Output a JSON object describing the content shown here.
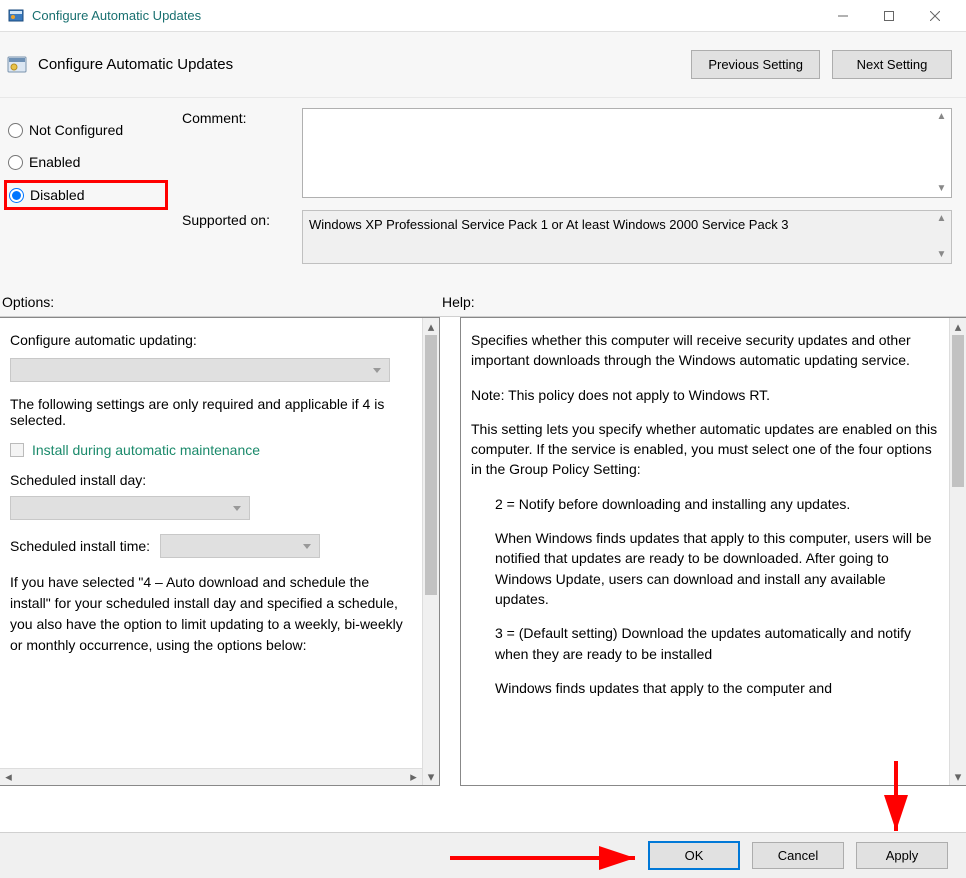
{
  "window": {
    "title": "Configure Automatic Updates"
  },
  "header": {
    "policy_title": "Configure Automatic Updates",
    "prev_button": "Previous Setting",
    "next_button": "Next Setting"
  },
  "state_radios": {
    "not_configured": "Not Configured",
    "enabled": "Enabled",
    "disabled": "Disabled",
    "selected": "disabled"
  },
  "fields": {
    "comment_label": "Comment:",
    "comment_value": "",
    "supported_label": "Supported on:",
    "supported_value": "Windows XP Professional Service Pack 1 or At least Windows 2000 Service Pack 3"
  },
  "labels": {
    "options": "Options:",
    "help": "Help:"
  },
  "options": {
    "configure_label": "Configure automatic updating:",
    "note1": "The following settings are only required and applicable if 4 is selected.",
    "maintenance_label": "Install during automatic maintenance",
    "day_label": "Scheduled install day:",
    "time_label": "Scheduled install time:",
    "note2": "If you have selected \"4 – Auto download and schedule the install\" for your scheduled install day and specified a schedule, you also have the option to limit updating to a weekly, bi-weekly or monthly occurrence, using the options below:"
  },
  "help": {
    "p1": "Specifies whether this computer will receive security updates and other important downloads through the Windows automatic updating service.",
    "p2": "Note: This policy does not apply to Windows RT.",
    "p3": "This setting lets you specify whether automatic updates are enabled on this computer. If the service is enabled, you must select one of the four options in the Group Policy Setting:",
    "opt2": "2 = Notify before downloading and installing any updates.",
    "opt2_desc": "When Windows finds updates that apply to this computer, users will be notified that updates are ready to be downloaded. After going to Windows Update, users can download and install any available updates.",
    "opt3": "3 = (Default setting) Download the updates automatically and notify when they are ready to be installed",
    "opt3_desc": "Windows finds updates that apply to the computer and"
  },
  "buttons": {
    "ok": "OK",
    "cancel": "Cancel",
    "apply": "Apply"
  }
}
